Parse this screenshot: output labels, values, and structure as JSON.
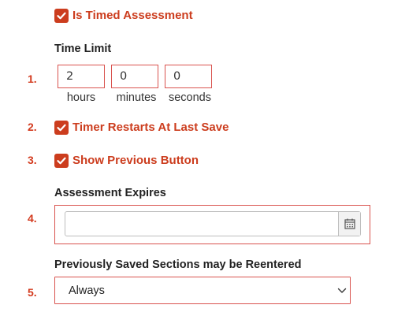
{
  "accent_color": "#cc3d1e",
  "timed_assessment": {
    "label": "Is Timed Assessment",
    "checked": true,
    "icon": "check-icon"
  },
  "time_limit": {
    "label": "Time Limit",
    "step": "1.",
    "fields": [
      {
        "value": "2",
        "unit": "hours"
      },
      {
        "value": "0",
        "unit": "minutes"
      },
      {
        "value": "0",
        "unit": "seconds"
      }
    ]
  },
  "timer_restarts": {
    "step": "2.",
    "label": "Timer Restarts At Last Save",
    "checked": true
  },
  "show_previous": {
    "step": "3.",
    "label": "Show Previous Button",
    "checked": true
  },
  "assessment_expires": {
    "step": "4.",
    "label": "Assessment Expires",
    "value": "",
    "icon": "calendar-icon"
  },
  "reenter_sections": {
    "step": "5.",
    "label": "Previously Saved Sections may be Reentered",
    "selected": "Always",
    "icon": "chevron-down-icon"
  }
}
